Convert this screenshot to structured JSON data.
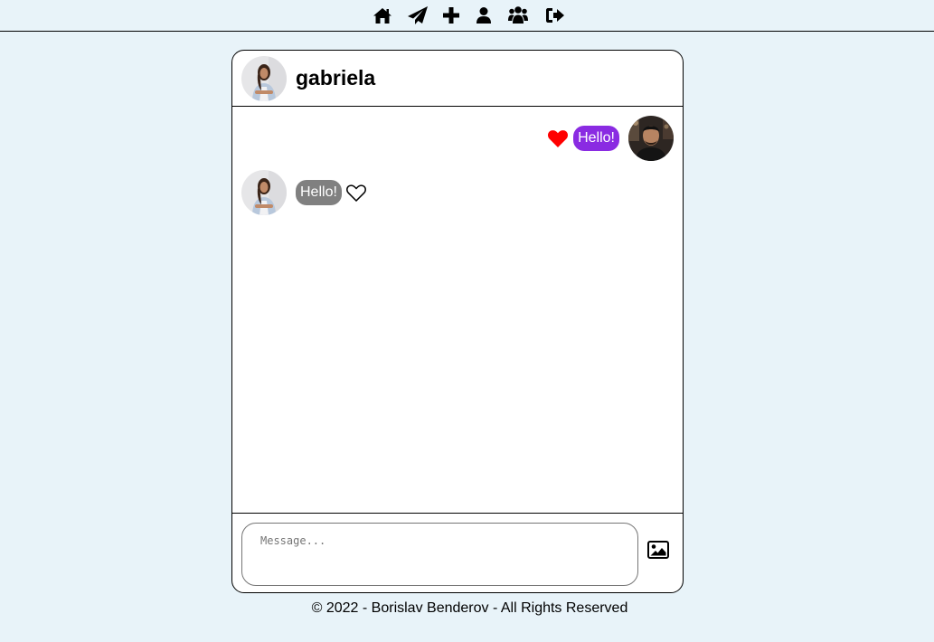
{
  "nav": {
    "icons": [
      "home-icon",
      "send-icon",
      "plus-icon",
      "user-icon",
      "users-icon",
      "sign-out-icon"
    ]
  },
  "chat": {
    "partner_name": "gabriela",
    "messages": [
      {
        "direction": "sent",
        "text": "Hello!",
        "liked": true
      },
      {
        "direction": "received",
        "text": "Hello!",
        "liked": false
      }
    ]
  },
  "composer": {
    "placeholder": "Message...",
    "value": ""
  },
  "footer": {
    "text": "© 2022 - Borislav Benderov - All Rights Reserved"
  },
  "colors": {
    "page_bg": "#e8f3f9",
    "sent_bubble": "#8a2be2",
    "received_bubble": "#808080",
    "liked_heart": "#ff0000"
  }
}
